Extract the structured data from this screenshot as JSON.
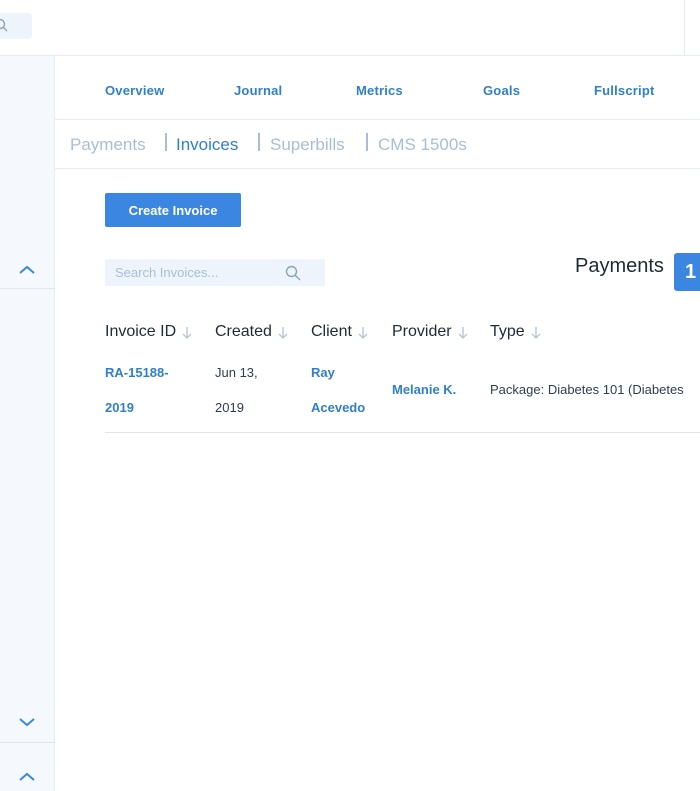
{
  "nav": {
    "items": [
      {
        "label": "Overview"
      },
      {
        "label": "Journal"
      },
      {
        "label": "Metrics"
      },
      {
        "label": "Goals"
      },
      {
        "label": "Fullscript"
      }
    ]
  },
  "subtabs": {
    "items": [
      {
        "label": "Payments",
        "active": false
      },
      {
        "label": "Invoices",
        "active": true
      },
      {
        "label": "Superbills",
        "active": false
      },
      {
        "label": "CMS 1500s",
        "active": false
      }
    ]
  },
  "actions": {
    "create_invoice_label": "Create Invoice"
  },
  "search": {
    "placeholder": "Search Invoices..."
  },
  "payments_panel": {
    "label": "Payments",
    "badge": "1"
  },
  "table": {
    "headers": [
      "Invoice ID",
      "Created",
      "Client",
      "Provider",
      "Type"
    ],
    "rows": [
      {
        "invoice_id_line1": "RA-15188-",
        "invoice_id_line2": "2019",
        "created_line1": "Jun 13,",
        "created_line2": "2019",
        "client_line1": "Ray",
        "client_line2": "Acevedo",
        "provider": "Melanie K.",
        "type": "Package: Diabetes 101 (Diabetes"
      }
    ]
  },
  "colors": {
    "accent": "#3b86e0",
    "link": "#2f80c9",
    "muted": "#a9bfd1",
    "sidebar_bg": "#f5f9fe"
  },
  "icons": {
    "top_search": "search-icon",
    "sidebar": [
      "chevron-up-icon",
      "chevron-down-icon",
      "chevron-up-icon"
    ],
    "sort": "arrow-down-icon"
  }
}
